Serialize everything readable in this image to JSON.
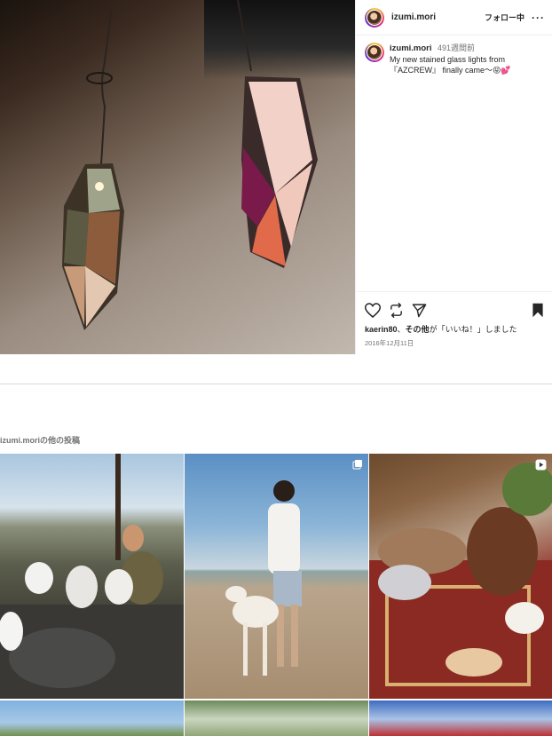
{
  "post": {
    "username": "izumi.mori",
    "follow_label": "フォロー中",
    "more_label": "···",
    "caption": {
      "username": "izumi.mori",
      "time": "491週間前",
      "line1": "My new stained glass lights from",
      "line2": "『AZCREW』 finally came〜😝💕"
    },
    "likes": {
      "user": "kaerin80",
      "sep": "、",
      "others": "その他",
      "suffix": "が「いいね！」しました"
    },
    "date": "2016年12月11日"
  },
  "more_posts": {
    "username": "izumi.mori",
    "suffix": "の他の投稿"
  },
  "icons": {
    "like": "heart-icon",
    "repost": "repost-icon",
    "share": "send-icon",
    "save": "bookmark-icon",
    "carousel": "carousel-icon",
    "reel": "reel-icon"
  }
}
